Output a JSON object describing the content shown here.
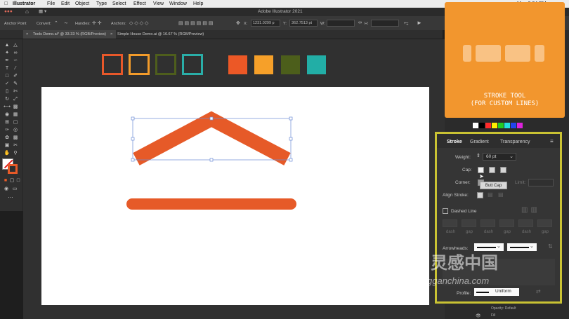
{
  "menubar": {
    "app": "Illustrator",
    "items": [
      "File",
      "Edit",
      "Object",
      "Type",
      "Select",
      "Effect",
      "View",
      "Window",
      "Help"
    ],
    "clock": "Mon 3:34 PM"
  },
  "window": {
    "title": "Adobe Illustrator 2021"
  },
  "controlbar": {
    "anchor_label": "Anchor Point",
    "convert_label": "Convert:",
    "handles_label": "Handles:",
    "anchors_label": "Anchors:",
    "x_value": "1231.0299 p",
    "y_value": "362.7513 pt",
    "w_label": "W:",
    "h_label": "H:"
  },
  "tabs": [
    {
      "label": "Tools Demo.ai* @ 33.33 % (RGB/Preview)",
      "active": true
    },
    {
      "label": "Simple House Demo.ai @ 16.67 % (RGB/Preview)",
      "active": false
    }
  ],
  "swatches": {
    "outline": [
      "#e8582a",
      "#f39b2a",
      "#4e5e1c",
      "#2aaea8"
    ],
    "filled": [
      "#ec5826",
      "#f6a029",
      "#4c5e1b",
      "#22aea6"
    ]
  },
  "art": {
    "stroke_color": "#e65a28"
  },
  "stroke_panel": {
    "tabs": [
      "Stroke",
      "Gradient",
      "Transparency"
    ],
    "weight_label": "Weight:",
    "weight_value": "60 pt",
    "cap_label": "Cap:",
    "corner_label": "Corner:",
    "limit_label": "Limit:",
    "align_label": "Align Stroke:",
    "dashed_label": "Dashed Line",
    "dash_labels": [
      "dash",
      "gap",
      "dash",
      "gap",
      "dash",
      "gap"
    ],
    "arrowheads_label": "Arrowheads:",
    "profile_label": "Profile:",
    "profile_value": "Uniform",
    "tooltip": "Butt Cap"
  },
  "card": {
    "title_line1": "STROKE TOOL",
    "title_line2": "(FOR CUSTOM LINES)",
    "color": "#f2962e"
  },
  "dock_bottom": {
    "opacity_label": "Opacity: Default",
    "fill_label": "Fill"
  },
  "watermark": {
    "text_cn": "灵感中国",
    "text_url": "lingganchina.com"
  }
}
